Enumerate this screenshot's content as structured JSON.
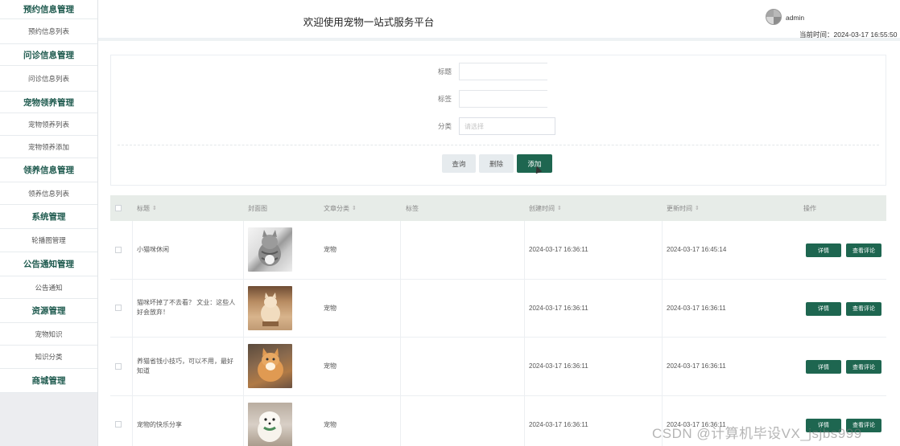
{
  "sidebar": {
    "sections": [
      {
        "title": "预约信息管理",
        "items": [
          "预约信息列表"
        ]
      },
      {
        "title": "问诊信息管理",
        "items": [
          "问诊信息列表"
        ]
      },
      {
        "title": "宠物领养管理",
        "items": [
          "宠物领养列表",
          "宠物领养添加"
        ]
      },
      {
        "title": "领养信息管理",
        "items": [
          "领养信息列表"
        ]
      },
      {
        "title": "系统管理",
        "items": [
          "轮播图管理"
        ]
      },
      {
        "title": "公告通知管理",
        "items": [
          "公告通知"
        ]
      },
      {
        "title": "资源管理",
        "items": [
          "宠物知识",
          "知识分类"
        ]
      },
      {
        "title": "商城管理",
        "items": []
      }
    ]
  },
  "header": {
    "title": "欢迎使用宠物一站式服务平台",
    "username": "admin",
    "time": "当前时间：2024-03-17 16:55:50"
  },
  "search": {
    "title_label": "标题",
    "tag_label": "标签",
    "category_label": "分类",
    "category_placeholder": "请选择",
    "query_button": "查询",
    "delete_button": "删除",
    "add_button": "添加"
  },
  "table": {
    "headers": [
      "标题",
      "封面图",
      "文章分类",
      "标签",
      "创建时间",
      "更新时间",
      "操作"
    ],
    "rows": [
      {
        "title": "小猫咪休闲",
        "category": "宠物",
        "tag": "",
        "created": "2024-03-17 16:36:11",
        "updated": "2024-03-17 16:45:14",
        "image": "cat-gray"
      },
      {
        "title": "猫咪坏掉了不去看？ 文业：这些人好会放弃！",
        "category": "宠物",
        "tag": "",
        "created": "2024-03-17 16:36:11",
        "updated": "2024-03-17 16:36:11",
        "image": "cat-cream"
      },
      {
        "title": "养猫省钱小技巧，可以不用，最好知道",
        "category": "宠物",
        "tag": "",
        "created": "2024-03-17 16:36:11",
        "updated": "2024-03-17 16:36:11",
        "image": "cat-orange"
      },
      {
        "title": "宠物的快乐分享",
        "category": "宠物",
        "tag": "",
        "created": "2024-03-17 16:36:11",
        "updated": "2024-03-17 16:36:11",
        "image": "dog-white"
      }
    ],
    "detail_button": "详情",
    "comment_button": "查看评论"
  },
  "watermark": "CSDN @计算机毕设VX_jsjbs999",
  "colors": {
    "primary": "#1e6650",
    "sidebar_heading": "#1e5a4e"
  }
}
